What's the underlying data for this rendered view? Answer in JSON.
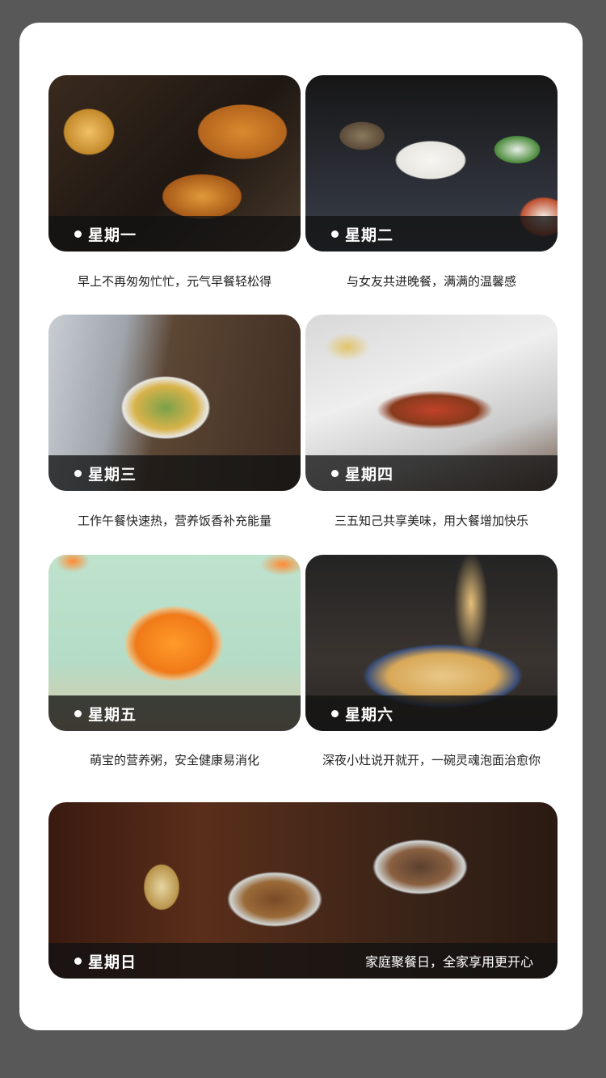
{
  "days": [
    {
      "label": "星期一",
      "caption": "早上不再匆匆忙忙，元气早餐轻松得"
    },
    {
      "label": "星期二",
      "caption": "与女友共进晚餐，满满的温馨感"
    },
    {
      "label": "星期三",
      "caption": "工作午餐快速热，营养饭香补充能量"
    },
    {
      "label": "星期四",
      "caption": "三五知己共享美味，用大餐增加快乐"
    },
    {
      "label": "星期五",
      "caption": "萌宝的营养粥，安全健康易消化"
    },
    {
      "label": "星期六",
      "caption": "深夜小灶说开就开，一碗灵魂泡面治愈你"
    }
  ],
  "sunday": {
    "label": "星期日",
    "slogan": "家庭聚餐日，全家享用更开心"
  }
}
